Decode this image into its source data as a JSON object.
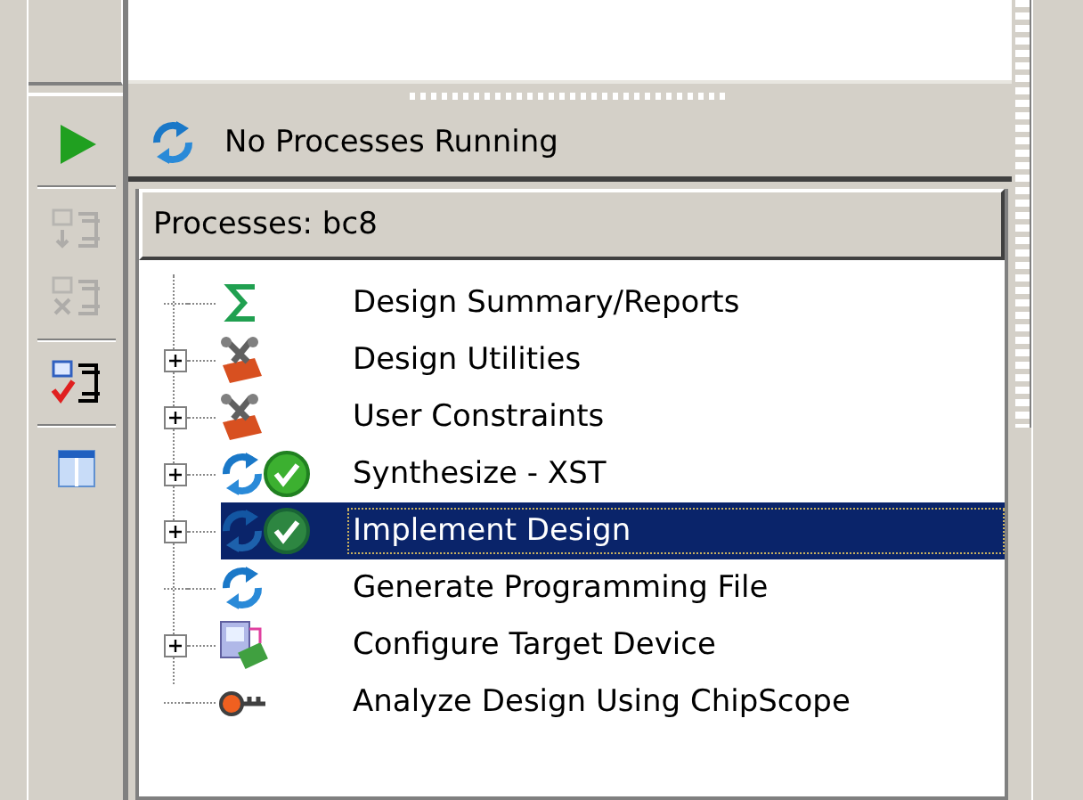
{
  "toolbar": [
    {
      "kind": "run",
      "disabled": false
    },
    {
      "kind": "add",
      "disabled": true
    },
    {
      "kind": "remove",
      "disabled": true
    },
    {
      "kind": "check",
      "disabled": false
    },
    {
      "kind": "panel",
      "disabled": false
    }
  ],
  "status": {
    "text": "No Processes Running"
  },
  "processes": {
    "title": "Processes: bc8",
    "items": [
      {
        "label": "Design Summary/Reports",
        "kind": "summary",
        "expandable": false,
        "done": false,
        "selected": false
      },
      {
        "label": "Design Utilities",
        "kind": "tools",
        "expandable": true,
        "done": false,
        "selected": false
      },
      {
        "label": "User Constraints",
        "kind": "tools",
        "expandable": true,
        "done": false,
        "selected": false
      },
      {
        "label": "Synthesize - XST",
        "kind": "process",
        "expandable": true,
        "done": true,
        "selected": false
      },
      {
        "label": "Implement Design",
        "kind": "process",
        "expandable": true,
        "done": true,
        "selected": true
      },
      {
        "label": "Generate Programming File",
        "kind": "process",
        "expandable": false,
        "done": false,
        "selected": false
      },
      {
        "label": "Configure Target Device",
        "kind": "device",
        "expandable": true,
        "done": false,
        "selected": false
      },
      {
        "label": "Analyze Design Using ChipScope",
        "kind": "scope",
        "expandable": false,
        "done": false,
        "selected": false
      }
    ]
  }
}
